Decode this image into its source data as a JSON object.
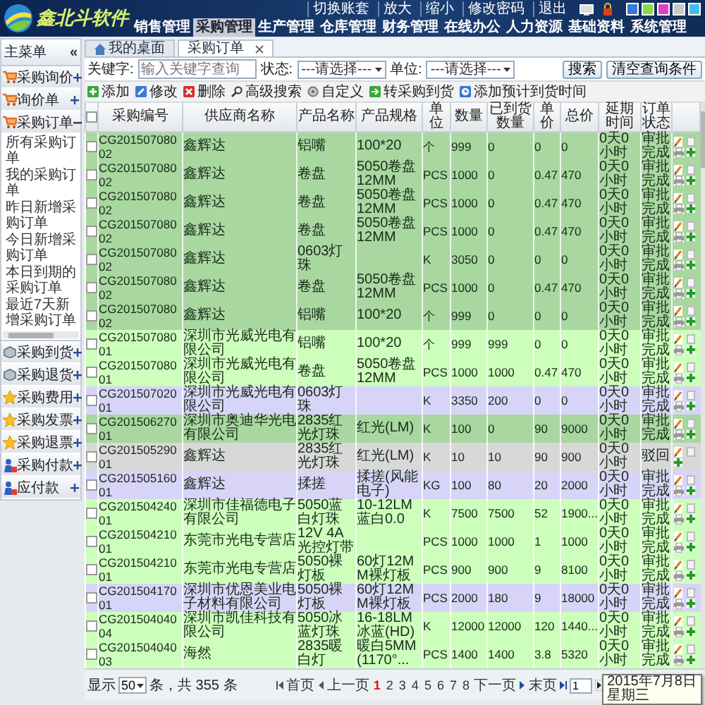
{
  "header": {
    "logo": "鑫北斗软件",
    "links": [
      "切换账套",
      "放大",
      "缩小",
      "修改密码",
      "退出"
    ],
    "swatches": [
      {
        "color": "#3a78d8"
      },
      {
        "color": "#88dd44"
      },
      {
        "color": "#e040c8"
      },
      {
        "color": "#c8c8c8"
      },
      {
        "color": "#40c0f0"
      }
    ],
    "nav": [
      {
        "label": "销售管理",
        "selected": false
      },
      {
        "label": "采购管理",
        "selected": true
      },
      {
        "label": "生产管理",
        "selected": false
      },
      {
        "label": "仓库管理",
        "selected": false
      },
      {
        "label": "财务管理",
        "selected": false
      },
      {
        "label": "在线办公",
        "selected": false
      },
      {
        "label": "人力资源",
        "selected": false
      },
      {
        "label": "基础资料",
        "selected": false
      },
      {
        "label": "系统管理",
        "selected": false
      }
    ]
  },
  "sidebar": {
    "title": "主菜单",
    "collapse": "«",
    "items": [
      {
        "label": "采购询价",
        "expanded": false
      },
      {
        "label": "询价单",
        "expanded": false
      },
      {
        "label": "采购订单",
        "expanded": true,
        "children": [
          {
            "label": "所有采购订单"
          },
          {
            "label": "我的采购订单"
          },
          {
            "label": "昨日新增采购订单"
          },
          {
            "label": "今日新增采购订单"
          },
          {
            "label": "本日到期的采购订单"
          },
          {
            "label": "最近7天新增采购订单"
          }
        ]
      },
      {
        "label": "采购到货",
        "expanded": false
      },
      {
        "label": "采购退货",
        "expanded": false
      },
      {
        "label": "采购费用",
        "expanded": false
      },
      {
        "label": "采购发票",
        "expanded": false
      },
      {
        "label": "采购退票",
        "expanded": false
      },
      {
        "label": "采购付款",
        "expanded": false
      },
      {
        "label": "应付款",
        "expanded": false
      }
    ]
  },
  "tabs": [
    {
      "label": "我的桌面",
      "selected": false,
      "closable": false
    },
    {
      "label": "采购订单",
      "selected": true,
      "closable": true
    }
  ],
  "search": {
    "keyword_label": "关键字:",
    "keyword_placeholder": "输入关键字查询",
    "status_label": "状态:",
    "status_value": "---请选择---",
    "unit_label": "单位:",
    "unit_value": "---请选择---",
    "buttons": [
      "搜索",
      "清空查询条件"
    ]
  },
  "toolbar": [
    "添加",
    "修改",
    "删除",
    "高级搜索",
    "自定义",
    "转采购到货",
    "添加预计到货时间"
  ],
  "table": {
    "header_checked": false,
    "columns": [
      "采购编号",
      "供应商名称",
      "产品名称",
      "产品规格",
      "单位",
      "数量",
      "已到货数量",
      "单价",
      "总价",
      "延期时间",
      "订单状态"
    ],
    "rows": [
      {
        "color": "#a8d8a0",
        "checked": false,
        "print": true,
        "cells": [
          "CG20150708002",
          "鑫辉达",
          "铝嘴",
          "100*20",
          "个",
          "999",
          "0",
          "0",
          "0",
          "0天0小时",
          "审批完成"
        ]
      },
      {
        "color": "#a8d8a0",
        "checked": false,
        "print": true,
        "cells": [
          "CG20150708002",
          "鑫辉达",
          "卷盘",
          "5050卷盘12MM",
          "PCS",
          "1000",
          "0",
          "0.47",
          "470",
          "0天0小时",
          "审批完成"
        ]
      },
      {
        "color": "#a8d8a0",
        "checked": false,
        "print": true,
        "cells": [
          "CG20150708002",
          "鑫辉达",
          "卷盘",
          "5050卷盘12MM",
          "PCS",
          "1000",
          "0",
          "0.47",
          "470",
          "0天0小时",
          "审批完成"
        ]
      },
      {
        "color": "#a8d8a0",
        "checked": false,
        "print": true,
        "cells": [
          "CG20150708002",
          "鑫辉达",
          "卷盘",
          "5050卷盘12MM",
          "PCS",
          "1000",
          "0",
          "0.47",
          "470",
          "0天0小时",
          "审批完成"
        ]
      },
      {
        "color": "#a8d8a0",
        "checked": false,
        "print": true,
        "cells": [
          "CG20150708002",
          "鑫辉达",
          "0603灯珠",
          "",
          "K",
          "3050",
          "0",
          "0",
          "0",
          "0天0小时",
          "审批完成"
        ]
      },
      {
        "color": "#a8d8a0",
        "checked": false,
        "print": true,
        "cells": [
          "CG20150708002",
          "鑫辉达",
          "卷盘",
          "5050卷盘12MM",
          "PCS",
          "1000",
          "0",
          "0.47",
          "470",
          "0天0小时",
          "审批完成"
        ]
      },
      {
        "color": "#a8d8a0",
        "checked": false,
        "print": true,
        "cells": [
          "CG20150708002",
          "鑫辉达",
          "铝嘴",
          "100*20",
          "个",
          "999",
          "0",
          "0",
          "0",
          "0天0小时",
          "审批完成"
        ]
      },
      {
        "color": "#ccffbb",
        "checked": false,
        "print": true,
        "cells": [
          "CG20150708001",
          "深圳市光威光电有限公司",
          "铝嘴",
          "100*20",
          "个",
          "999",
          "999",
          "0",
          "0",
          "0天0小时",
          "审批完成"
        ]
      },
      {
        "color": "#ccffbb",
        "checked": false,
        "print": true,
        "cells": [
          "CG20150708001",
          "深圳市光威光电有限公司",
          "卷盘",
          "5050卷盘12MM",
          "PCS",
          "1000",
          "1000",
          "0.47",
          "470",
          "0天0小时",
          "审批完成"
        ]
      },
      {
        "color": "#d8d4f8",
        "checked": false,
        "print": true,
        "cells": [
          "CG20150702001",
          "深圳市光威光电有限公司",
          "0603灯珠",
          "",
          "K",
          "3350",
          "200",
          "0",
          "0",
          "0天0小时",
          "审批完成"
        ]
      },
      {
        "color": "#a8d8a0",
        "checked": false,
        "print": true,
        "cells": [
          "CG20150627001",
          "深圳市奥迪华光电有限公司",
          "2835红光灯珠",
          "红光(LM)",
          "K",
          "100",
          "0",
          "90",
          "9000",
          "0天0小时",
          "审批完成"
        ]
      },
      {
        "color": "#d8d8d8",
        "checked": false,
        "print": false,
        "cells": [
          "CG20150529001",
          "鑫辉达",
          "2835红光灯珠",
          "红光(LM)",
          "K",
          "10",
          "10",
          "90",
          "900",
          "0天0小时",
          "驳回"
        ]
      },
      {
        "color": "#d8d4f8",
        "checked": false,
        "print": true,
        "cells": [
          "CG20150516001",
          "鑫辉达",
          "揉搓",
          "揉搓(风能电子)",
          "KG",
          "100",
          "80",
          "20",
          "2000",
          "0天0小时",
          "审批完成"
        ]
      },
      {
        "color": "#ccffbb",
        "checked": false,
        "print": true,
        "cells": [
          "CG20150424001",
          "深圳市佳福德电子有限公司",
          "5050蓝白灯珠",
          "10-12LM蓝白0.0",
          "K",
          "7500",
          "7500",
          "52",
          "1900...",
          "0天0小时",
          "审批完成"
        ]
      },
      {
        "color": "#ccffbb",
        "checked": false,
        "print": true,
        "cells": [
          "CG20150421001",
          "东莞市光电专营店",
          "12V 4A光控灯带",
          "",
          "PCS",
          "1000",
          "1000",
          "1",
          "1000",
          "0天0小时",
          "审批完成"
        ]
      },
      {
        "color": "#ccffbb",
        "checked": false,
        "print": true,
        "cells": [
          "CG20150421001",
          "东莞市光电专营店",
          "5050裸灯板",
          "60灯12MM裸灯板",
          "PCS",
          "900",
          "900",
          "9",
          "8100",
          "0天0小时",
          "审批完成"
        ]
      },
      {
        "color": "#d8d4f8",
        "checked": false,
        "print": true,
        "cells": [
          "CG20150417001",
          "深圳市优恩美业电子材料有限公司",
          "5050裸灯板",
          "60灯12MM裸灯板",
          "PCS",
          "2000",
          "180",
          "9",
          "18000",
          "0天0小时",
          "审批完成"
        ]
      },
      {
        "color": "#ccffbb",
        "checked": false,
        "print": true,
        "cells": [
          "CG20150404004",
          "深圳市凯佳科技有限公司",
          "5050冰蓝灯珠",
          "16-18LM冰蓝(HD)",
          "K",
          "12000",
          "12000",
          "120",
          "1440...",
          "0天0小时",
          "审批完成"
        ]
      },
      {
        "color": "#ccffbb",
        "checked": false,
        "print": true,
        "cells": [
          "CG20150404003",
          "海然",
          "2835暖白灯",
          "暖白5MM(1170°...",
          "PCS",
          "1400",
          "1400",
          "3.8",
          "5320",
          "0天0小时",
          "审批完成"
        ]
      }
    ]
  },
  "pager": {
    "show_label": "显示",
    "page_size": "50",
    "total": "条，共 355 条",
    "first": "首页",
    "prev": "上一页",
    "pages": [
      {
        "label": "1",
        "selected": true
      },
      {
        "label": "2",
        "selected": false
      },
      {
        "label": "3",
        "selected": false
      },
      {
        "label": "4",
        "selected": false
      },
      {
        "label": "5",
        "selected": false
      },
      {
        "label": "6",
        "selected": false
      },
      {
        "label": "7",
        "selected": false
      },
      {
        "label": "8",
        "selected": false
      }
    ],
    "next": "下一页",
    "last": "末页",
    "page_input": "1"
  },
  "tooltip": {
    "lines": [
      "2015年7月8日",
      "星期三"
    ]
  }
}
